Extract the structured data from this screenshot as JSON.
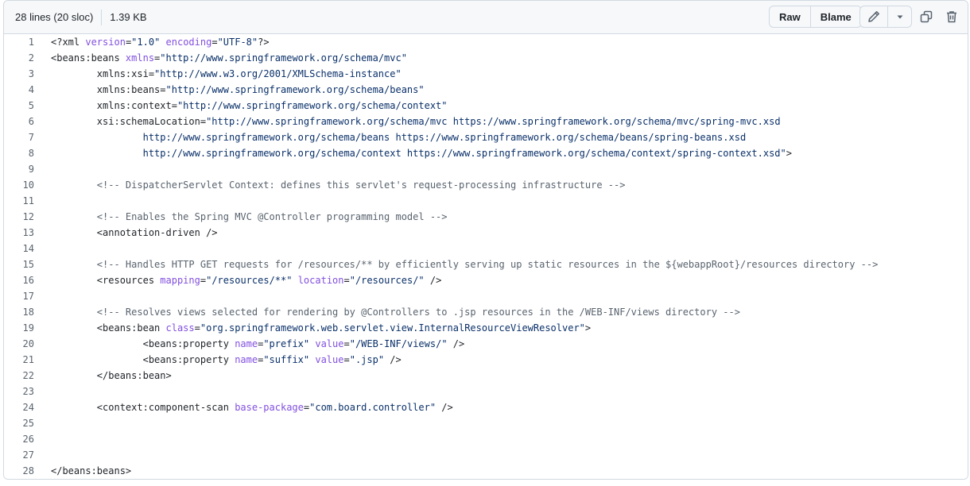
{
  "header": {
    "lines_info": "28 lines (20 sloc)",
    "size_info": "1.39 KB",
    "raw_label": "Raw",
    "blame_label": "Blame",
    "edit_icon": "pencil-icon",
    "more_icon": "triangle-down-icon",
    "copy_icon": "copy-icon",
    "delete_icon": "trash-icon"
  },
  "code": {
    "lines": [
      [
        [
          "t",
          "<?xml "
        ],
        [
          "a",
          "version"
        ],
        [
          "t",
          "="
        ],
        [
          "s",
          "\"1.0\""
        ],
        [
          "t",
          " "
        ],
        [
          "a",
          "encoding"
        ],
        [
          "t",
          "="
        ],
        [
          "s",
          "\"UTF-8\""
        ],
        [
          "t",
          "?>"
        ]
      ],
      [
        [
          "t",
          "<beans:beans "
        ],
        [
          "a",
          "xmlns"
        ],
        [
          "t",
          "="
        ],
        [
          "s",
          "\"http://www.springframework.org/schema/mvc\""
        ]
      ],
      [
        [
          "t",
          "        xmlns:xsi="
        ],
        [
          "s",
          "\"http://www.w3.org/2001/XMLSchema-instance\""
        ]
      ],
      [
        [
          "t",
          "        xmlns:beans="
        ],
        [
          "s",
          "\"http://www.springframework.org/schema/beans\""
        ]
      ],
      [
        [
          "t",
          "        xmlns:context="
        ],
        [
          "s",
          "\"http://www.springframework.org/schema/context\""
        ]
      ],
      [
        [
          "t",
          "        xsi:schemaLocation="
        ],
        [
          "s",
          "\"http://www.springframework.org/schema/mvc https://www.springframework.org/schema/mvc/spring-mvc.xsd"
        ]
      ],
      [
        [
          "s",
          "                http://www.springframework.org/schema/beans https://www.springframework.org/schema/beans/spring-beans.xsd"
        ]
      ],
      [
        [
          "s",
          "                http://www.springframework.org/schema/context https://www.springframework.org/schema/context/spring-context.xsd\""
        ],
        [
          "t",
          ">"
        ]
      ],
      [],
      [
        [
          "c",
          "        <!-- DispatcherServlet Context: defines this servlet's request-processing infrastructure -->"
        ]
      ],
      [],
      [
        [
          "c",
          "        <!-- Enables the Spring MVC @Controller programming model -->"
        ]
      ],
      [
        [
          "t",
          "        <annotation-driven />"
        ]
      ],
      [],
      [
        [
          "c",
          "        <!-- Handles HTTP GET requests for /resources/** by efficiently serving up static resources in the ${webappRoot}/resources directory -->"
        ]
      ],
      [
        [
          "t",
          "        <resources "
        ],
        [
          "a",
          "mapping"
        ],
        [
          "t",
          "="
        ],
        [
          "s",
          "\"/resources/**\""
        ],
        [
          "t",
          " "
        ],
        [
          "a",
          "location"
        ],
        [
          "t",
          "="
        ],
        [
          "s",
          "\"/resources/\""
        ],
        [
          "t",
          " />"
        ]
      ],
      [],
      [
        [
          "c",
          "        <!-- Resolves views selected for rendering by @Controllers to .jsp resources in the /WEB-INF/views directory -->"
        ]
      ],
      [
        [
          "t",
          "        <beans:bean "
        ],
        [
          "a",
          "class"
        ],
        [
          "t",
          "="
        ],
        [
          "s",
          "\"org.springframework.web.servlet.view.InternalResourceViewResolver\""
        ],
        [
          "t",
          ">"
        ]
      ],
      [
        [
          "t",
          "                <beans:property "
        ],
        [
          "a",
          "name"
        ],
        [
          "t",
          "="
        ],
        [
          "s",
          "\"prefix\""
        ],
        [
          "t",
          " "
        ],
        [
          "a",
          "value"
        ],
        [
          "t",
          "="
        ],
        [
          "s",
          "\"/WEB-INF/views/\""
        ],
        [
          "t",
          " />"
        ]
      ],
      [
        [
          "t",
          "                <beans:property "
        ],
        [
          "a",
          "name"
        ],
        [
          "t",
          "="
        ],
        [
          "s",
          "\"suffix\""
        ],
        [
          "t",
          " "
        ],
        [
          "a",
          "value"
        ],
        [
          "t",
          "="
        ],
        [
          "s",
          "\".jsp\""
        ],
        [
          "t",
          " />"
        ]
      ],
      [
        [
          "t",
          "        </beans:bean>"
        ]
      ],
      [],
      [
        [
          "t",
          "        <context:component-scan "
        ],
        [
          "a",
          "base-package"
        ],
        [
          "t",
          "="
        ],
        [
          "s",
          "\"com.board.controller\""
        ],
        [
          "t",
          " />"
        ]
      ],
      [],
      [],
      [],
      [
        [
          "t",
          "</beans:beans>"
        ]
      ]
    ]
  },
  "colors": {
    "attribute": "#8250df",
    "string": "#0a3069",
    "comment": "#59636e",
    "text": "#1f2328"
  }
}
